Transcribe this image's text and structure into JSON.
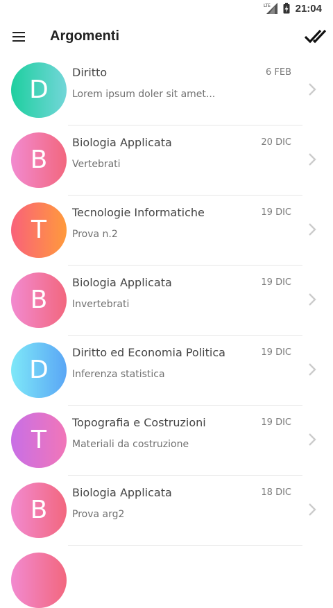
{
  "status_bar": {
    "network_label": "LTE",
    "time": "21:04"
  },
  "app_bar": {
    "title": "Argomenti",
    "left_icon": "menu-icon",
    "right_icon": "double-check-icon"
  },
  "items": [
    {
      "letter": "D",
      "title": "Diritto",
      "subtitle": "Lorem ipsum doler sit amet...",
      "date": "6 FEB",
      "colors": [
        "#1ecf9f",
        "#72d6d8"
      ]
    },
    {
      "letter": "B",
      "title": "Biologia Applicata",
      "subtitle": "Vertebrati",
      "date": "20 DIC",
      "colors": [
        "#f28ad0",
        "#f2677e"
      ]
    },
    {
      "letter": "T",
      "title": "Tecnologie Informatiche",
      "subtitle": "Prova n.2",
      "date": "19 DIC",
      "colors": [
        "#f9617a",
        "#ff9a3c"
      ]
    },
    {
      "letter": "B",
      "title": "Biologia Applicata",
      "subtitle": "Invertebrati",
      "date": "19 DIC",
      "colors": [
        "#f28ad0",
        "#f2677e"
      ]
    },
    {
      "letter": "D",
      "title": "Diritto ed Economia Politica",
      "subtitle": "Inferenza statistica",
      "date": "19 DIC",
      "colors": [
        "#7ee8f8",
        "#5aa6f5"
      ]
    },
    {
      "letter": "T",
      "title": "Topografia e Costruzioni",
      "subtitle": "Materiali da costruzione",
      "date": "19 DIC",
      "colors": [
        "#c86fe6",
        "#f176b8"
      ]
    },
    {
      "letter": "B",
      "title": "Biologia Applicata",
      "subtitle": "Prova arg2",
      "date": "18 DIC",
      "colors": [
        "#f28ad0",
        "#f2677e"
      ]
    }
  ],
  "peek_item": {
    "colors": [
      "#f28ad0",
      "#f2677e"
    ]
  },
  "colors": {
    "divider": "#e6e6e6",
    "chevron": "#cccccc",
    "title_text": "#444444"
  }
}
